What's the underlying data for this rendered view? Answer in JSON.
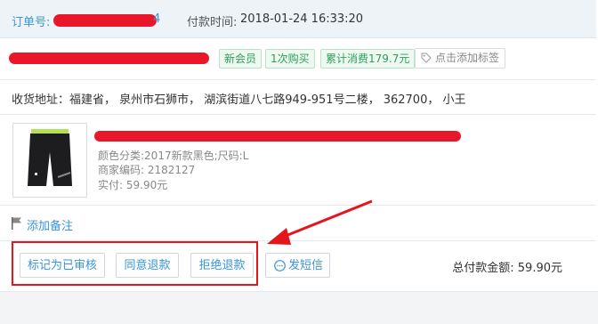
{
  "header": {
    "order_label": "订单号:",
    "order_id_tail": "4",
    "pay_time_label": "付款时间:",
    "pay_time_value": "2018-01-24 16:33:20"
  },
  "customer": {
    "tags": [
      "新会员",
      "1次购买",
      "累计消费179.7元"
    ],
    "add_tag_label": "点击添加标签"
  },
  "address": {
    "text": "收货地址：福建省，  泉州市石狮市，  湖滨街道八七路949-951号二楼，  362700，  小王"
  },
  "item": {
    "color_size": "颜色分类:2017新款黑色;尺码:L",
    "merchant_code": "商家编码:  2182127",
    "paid": "实付:  59.90元"
  },
  "note": {
    "add_note_label": "添加备注"
  },
  "actions": {
    "mark_reviewed": "标记为已审核",
    "agree_refund": "同意退款",
    "reject_refund": "拒绝退款",
    "send_sms": "发短信",
    "total_paid": "总付款金额:  59.90元"
  },
  "colors": {
    "accent": "#3a95d8",
    "tag_green": "#2f9c5a",
    "redaction": "#e8182a",
    "highlight_red": "#e4161d"
  }
}
